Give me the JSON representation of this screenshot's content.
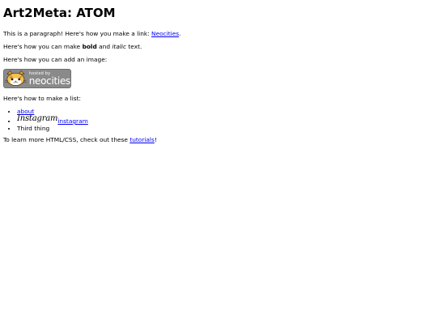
{
  "page": {
    "title": "Art2Meta: ATOM"
  },
  "para1": {
    "text_before": "This is a paragraph! Here's how you make a link: ",
    "link_label": "Neocities",
    "text_after": "."
  },
  "para2": {
    "text_before": "Here's how you can make ",
    "bold_text": "bold",
    "text_middle": " and ",
    "italic_text": "italic",
    "text_after": " text."
  },
  "para3": {
    "text": "Here's how you can add an image:"
  },
  "badge": {
    "small_text": "hosted by",
    "big_text": "neocities",
    "colors": {
      "background": "#8a8a8a",
      "cat": "#e8a23a"
    }
  },
  "para4": {
    "text": "Here's how to make a list:"
  },
  "list": {
    "item1_label": "about",
    "item2_logo_text": "Instagram",
    "item2_label": "instagram",
    "item3_text": "Third thing"
  },
  "para5": {
    "text_before": "To learn more HTML/CSS, check out these ",
    "link_label": "tutorials",
    "text_after": "!"
  }
}
